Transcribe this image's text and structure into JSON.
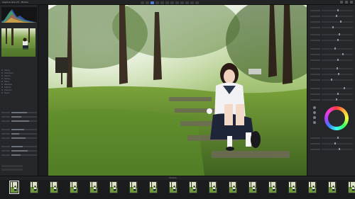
{
  "app": {
    "title": "Capture One 23 - Photos"
  },
  "toolbar": {
    "buttons": 12,
    "active_index": 2
  },
  "left_panel": {
    "sections": [
      "Library",
      "Collections",
      "Albums",
      "Folders",
      "Filters",
      "Metadata",
      "Capture",
      "Exposure",
      "Styles"
    ],
    "footer_buttons": [
      "Import",
      "Export"
    ]
  },
  "viewer": {
    "image_description_icon": "photo-portrait-icon"
  },
  "right_panel": {
    "color_wheel_icon": "color-balance-wheel-icon"
  },
  "filmstrip": {
    "label": "Filmstrip",
    "count": 18,
    "selected_index": 0
  },
  "colors": {
    "accent": "#4a7bd0",
    "panel_bg": "#252629",
    "app_bg": "#1b1c1e"
  }
}
